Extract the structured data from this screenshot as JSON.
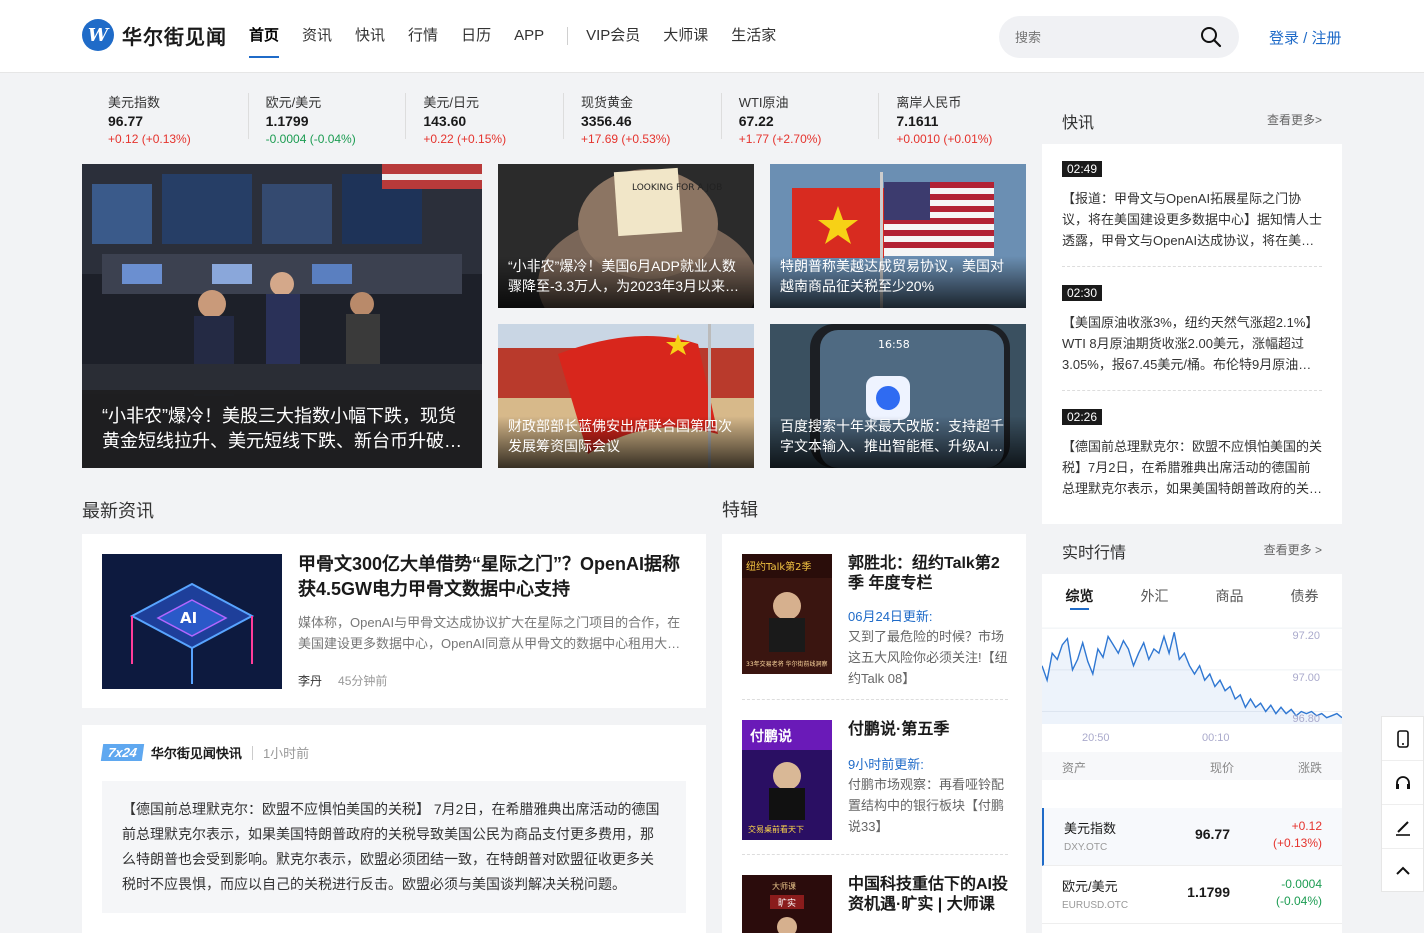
{
  "header": {
    "logo_text": "华尔街见闻",
    "nav": [
      "首页",
      "资讯",
      "快讯",
      "行情",
      "日历",
      "APP",
      "VIP会员",
      "大师课",
      "生活家"
    ],
    "search_placeholder": "搜索",
    "login": "登录 / 注册"
  },
  "ticker": [
    {
      "name": "美元指数",
      "value": "96.77",
      "change": "+0.12 (+0.13%)",
      "dir": "up"
    },
    {
      "name": "欧元/美元",
      "value": "1.1799",
      "change": "-0.0004 (-0.04%)",
      "dir": "down"
    },
    {
      "name": "美元/日元",
      "value": "143.60",
      "change": "+0.22 (+0.15%)",
      "dir": "up"
    },
    {
      "name": "现货黄金",
      "value": "3356.46",
      "change": "+17.69 (+0.53%)",
      "dir": "up"
    },
    {
      "name": "WTI原油",
      "value": "67.22",
      "change": "+1.77 (+2.70%)",
      "dir": "up"
    },
    {
      "name": "离岸人民币",
      "value": "7.1611",
      "change": "+0.0010 (+0.01%)",
      "dir": "up"
    }
  ],
  "hero": {
    "main": "“小非农”爆冷！美股三大指数小幅下跌，现货黄金短线拉升、美元短线下跌、新台币升破…",
    "item1": "“小非农”爆冷！美国6月ADP就业人数骤降至-3.3万人，为2023年3月以来…",
    "item2": "特朗普称美越达成贸易协议，美国对越南商品征关税至少20%",
    "item3": "财政部部长蓝佛安出席联合国第四次发展筹资国际会议",
    "item4": "百度搜索十年来最大改版：支持超千字文本输入、推出智能框、升级AI…",
    "job_sign": "LOOKING FOR A JOB",
    "phone_time": "16:58"
  },
  "latest": {
    "title": "最新资讯",
    "news": {
      "thumb_text": "AI",
      "title": "甲骨文300亿大单借势“星际之门”？OpenAI据称获4.5GW电力甲骨文数据中心支持",
      "summary": "媒体称，OpenAI与甲骨文达成协议扩大在星际之门项目的合作，在美国建设更多数据中心，OpenAI同意从甲骨文的数据中心租用大…",
      "author": "李丹",
      "time": "45分钟前"
    },
    "flash": {
      "tag": "7x24",
      "source": "华尔街见闻快讯",
      "time": "1小时前",
      "body": "【德国前总理默克尔：欧盟不应惧怕美国的关税】 7月2日，在希腊雅典出席活动的德国前总理默克尔表示，如果美国特朗普政府的关税导致美国公民为商品支付更多费用，那么特朗普也会受到影响。默克尔表示，欧盟必须团结一致，在特朗普对欧盟征收更多关税时不应畏惧，而应以自己的关税进行反击。欧盟必须与美国谈判解决关税问题。"
    }
  },
  "special": {
    "title": "特辑",
    "items": [
      {
        "title": "郭胜北：纽约Talk第2季 年度专栏",
        "update": "06月24日更新:",
        "desc": "又到了最危险的时候？市场这五大风险你必须关注!【纽约Talk 08】",
        "cover_text": "纽约Talk第2季",
        "cover_sub": "33年交易老将 华尔街前线洞察"
      },
      {
        "title": "付鹏说·第五季",
        "update": "9小时前更新:",
        "desc": "付鹏市场观察：再看哑铃配置结构中的银行板块【付鹏说33】",
        "cover_text": "付鹏说",
        "cover_sub": "交易桌前看天下"
      },
      {
        "title": "中国科技重估下的AI投资机遇·旷实 | 大师课",
        "cover_text": "大师课",
        "cover_sub": "旷实"
      }
    ]
  },
  "kuaixun": {
    "title": "快讯",
    "more": "查看更多>",
    "items": [
      {
        "time": "02:49",
        "text": "【报道：甲骨文与OpenAI拓展星际之门协议，将在美国建设更多数据中心】据知情人士透露，甲骨文与OpenAI达成协议，将在美…"
      },
      {
        "time": "02:30",
        "text": "【美国原油收涨3%，纽约天然气涨超2.1%】WTI 8月原油期货收涨2.00美元，涨幅超过3.05%，报67.45美元/桶。布伦特9月原油…"
      },
      {
        "time": "02:26",
        "text": "【德国前总理默克尔：欧盟不应惧怕美国的关税】7月2日，在希腊雅典出席活动的德国前总理默克尔表示，如果美国特朗普政府的关…"
      }
    ]
  },
  "market": {
    "title": "实时行情",
    "more": "查看更多 >",
    "tabs": [
      "综览",
      "外汇",
      "商品",
      "债券"
    ],
    "y_labels": [
      "97.20",
      "97.00",
      "96.80"
    ],
    "x_labels": [
      "20:50",
      "00:10"
    ],
    "headers": [
      "资产",
      "现价",
      "涨跌"
    ],
    "rows": [
      {
        "name": "美元指数",
        "code": "DXY.OTC",
        "price": "96.77",
        "chg": "+0.12",
        "pct": "(+0.13%)",
        "dir": "up"
      },
      {
        "name": "欧元/美元",
        "code": "EURUSD.OTC",
        "price": "1.1799",
        "chg": "-0.0004",
        "pct": "(-0.04%)",
        "dir": "down"
      }
    ],
    "series": [
      97.02,
      96.95,
      97.08,
      97.05,
      97.12,
      97.15,
      97.0,
      97.05,
      97.13,
      97.04,
      96.98,
      97.1,
      97.06,
      97.16,
      97.12,
      97.08,
      97.14,
      97.1,
      97.02,
      97.08,
      97.13,
      97.05,
      97.1,
      97.08,
      97.16,
      97.08,
      97.18,
      97.05,
      97.08,
      97.02,
      96.98,
      97.02,
      96.95,
      96.98,
      96.92,
      96.95,
      96.9,
      96.92,
      96.86,
      96.88,
      96.82,
      96.86,
      96.82,
      96.84,
      96.8,
      96.83,
      96.79,
      96.82,
      96.79,
      96.81,
      96.78,
      96.8,
      96.79,
      96.8,
      96.78,
      96.79,
      96.77,
      96.78,
      96.79,
      96.77
    ]
  }
}
